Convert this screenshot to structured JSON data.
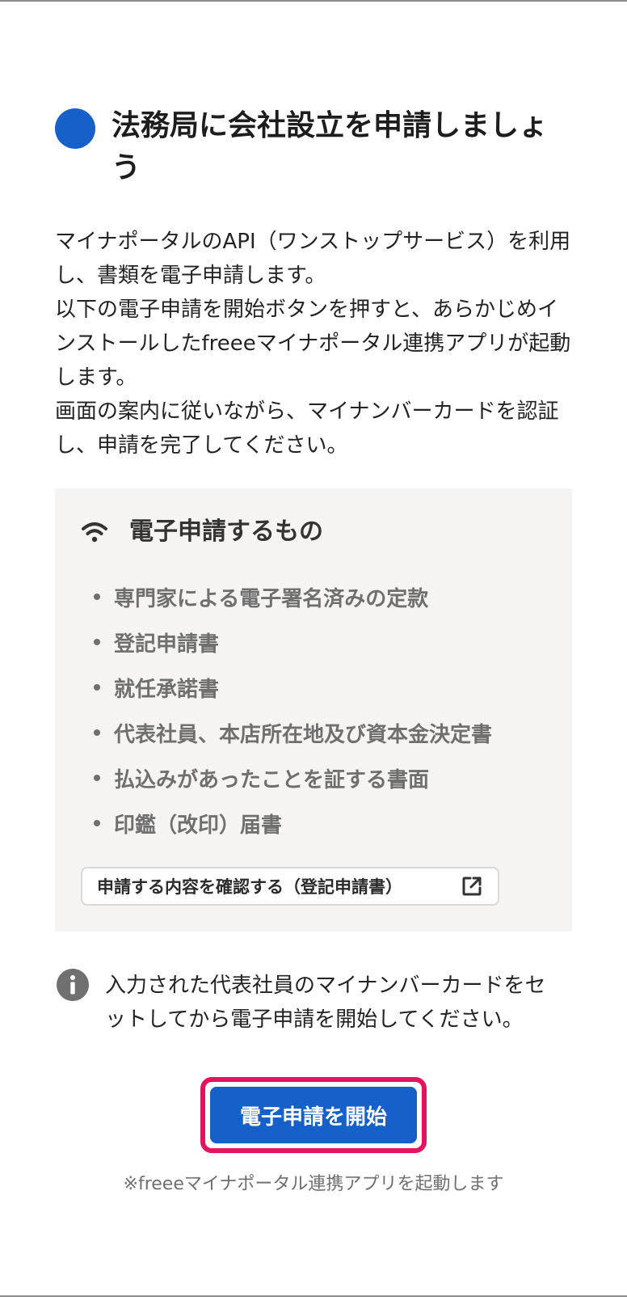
{
  "header": {
    "title": "法務局に会社設立を申請しましょう"
  },
  "description": "マイナポータルのAPI（ワンストップサービス）を利用し、書類を電子申請します。\n以下の電子申請を開始ボタンを押すと、あらかじめインストールしたfreeeマイナポータル連携アプリが起動します。\n画面の案内に従いながら、マイナンバーカードを認証し、申請を完了してください。",
  "panel": {
    "title": "電子申請するもの",
    "icon": "wifi-icon",
    "items": [
      "専門家による電子署名済みの定款",
      "登記申請書",
      "就任承諾書",
      "代表社員、本店所在地及び資本金決定書",
      "払込みがあったことを証する書面",
      "印鑑（改印）届書"
    ],
    "confirm_label": "申請する内容を確認する（登記申請書）"
  },
  "notice": {
    "icon": "info-icon",
    "text": "入力された代表社員のマイナンバーカードをセットしてから電子申請を開始してください。"
  },
  "cta": {
    "label": "電子申請を開始",
    "note": "※freeeマイナポータル連携アプリを起動します"
  },
  "colors": {
    "accent": "#1560c9",
    "highlight": "#e3135f",
    "panel_bg": "#f5f4f2",
    "muted_text": "#6f6f6f"
  }
}
